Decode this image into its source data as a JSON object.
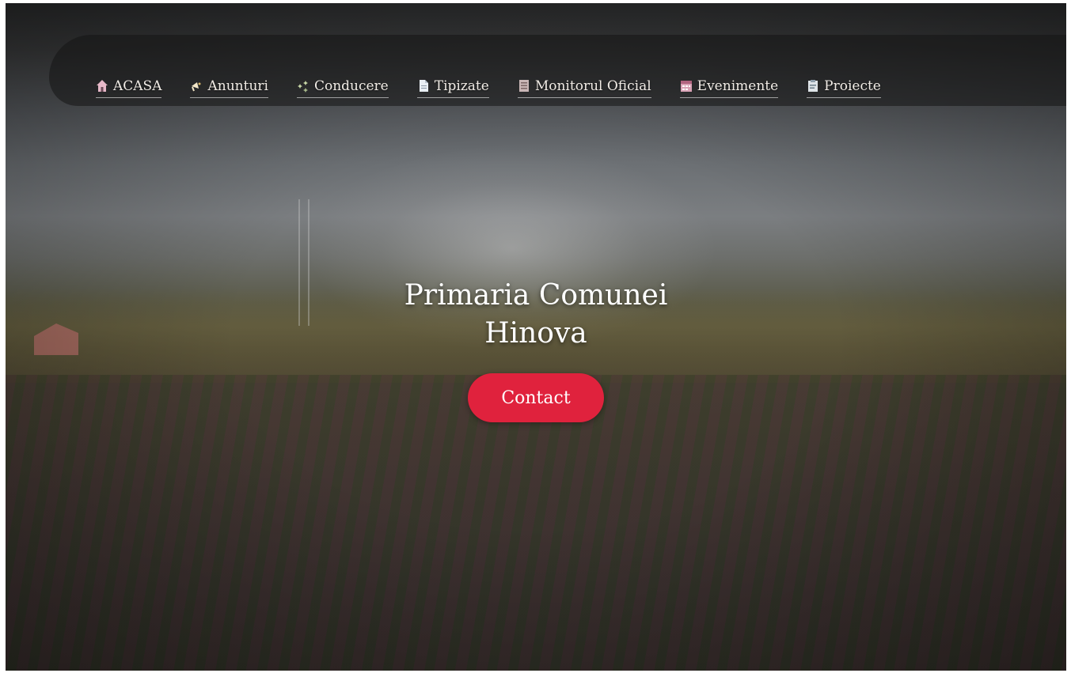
{
  "nav": {
    "items": [
      {
        "label": "ACASA",
        "icon": "home-icon",
        "color": "#e6b8c8"
      },
      {
        "label": "Anunturi",
        "icon": "megaphone-icon",
        "color": "#f2e6c8"
      },
      {
        "label": "Conducere",
        "icon": "sparkle-icon",
        "color": "#c9d9a8"
      },
      {
        "label": "Tipizate",
        "icon": "document-icon",
        "color": "#e9eef4"
      },
      {
        "label": "Monitorul Oficial",
        "icon": "ledger-icon",
        "color": "#c9b6b6"
      },
      {
        "label": "Evenimente",
        "icon": "calendar-icon",
        "color": "#d9a3b6"
      },
      {
        "label": "Proiecte",
        "icon": "clipboard-icon",
        "color": "#dfe4e8"
      }
    ]
  },
  "hero": {
    "title_line1": "Primaria Comunei",
    "title_line2": "Hinova",
    "contact_label": "Contact"
  },
  "colors": {
    "accent": "#e0223d",
    "nav_text": "#f1ece6"
  }
}
